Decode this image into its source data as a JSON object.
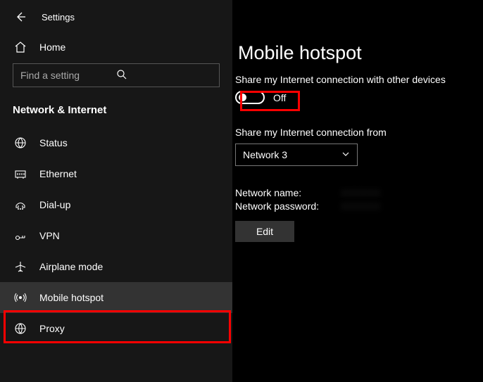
{
  "header": {
    "title": "Settings"
  },
  "home": {
    "label": "Home"
  },
  "search": {
    "placeholder": "Find a setting"
  },
  "section": {
    "title": "Network & Internet"
  },
  "nav": {
    "status": "Status",
    "ethernet": "Ethernet",
    "dialup": "Dial-up",
    "vpn": "VPN",
    "airplane": "Airplane mode",
    "hotspot": "Mobile hotspot",
    "proxy": "Proxy"
  },
  "main": {
    "title": "Mobile hotspot",
    "share_label": "Share my Internet connection with other devices",
    "toggle_state": "Off",
    "from_label": "Share my Internet connection from",
    "from_value": "Network 3",
    "name_label": "Network name:",
    "name_value": "XXXXXX",
    "password_label": "Network password:",
    "password_value": "XXXXXX",
    "edit": "Edit"
  }
}
